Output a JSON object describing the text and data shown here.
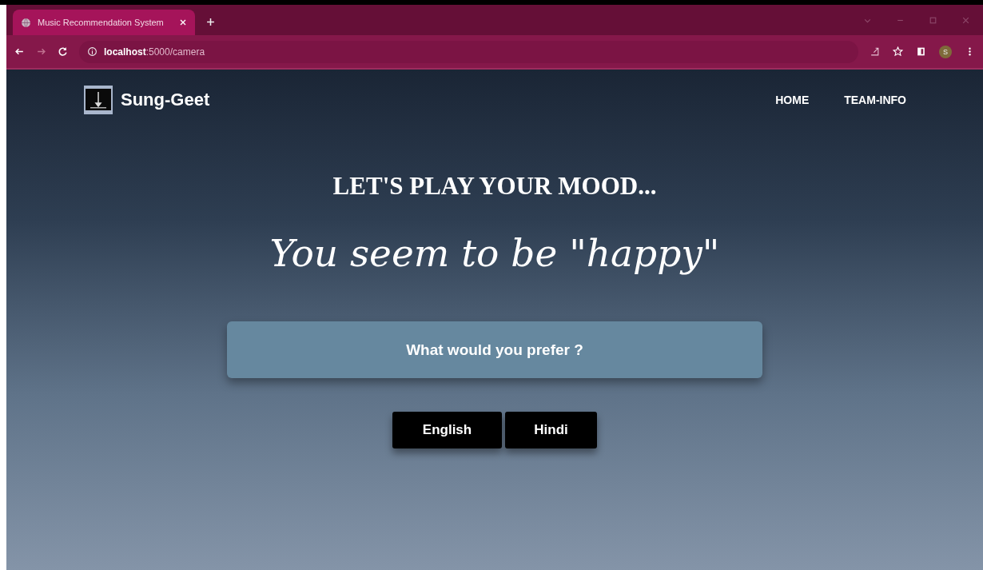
{
  "browser": {
    "tab_title": "Music Recommendation System",
    "url_host": "localhost",
    "url_path": ":5000/camera",
    "profile_initial": "S"
  },
  "nav": {
    "brand": "Sung-Geet",
    "links": [
      {
        "label": "HOME"
      },
      {
        "label": "TEAM-INFO"
      }
    ]
  },
  "heading": "LET'S PLAY YOUR MOOD...",
  "mood_text": "You seem to be \"happy\"",
  "prompt": "What would you prefer ?",
  "buttons": [
    {
      "label": "English"
    },
    {
      "label": "Hindi"
    }
  ]
}
